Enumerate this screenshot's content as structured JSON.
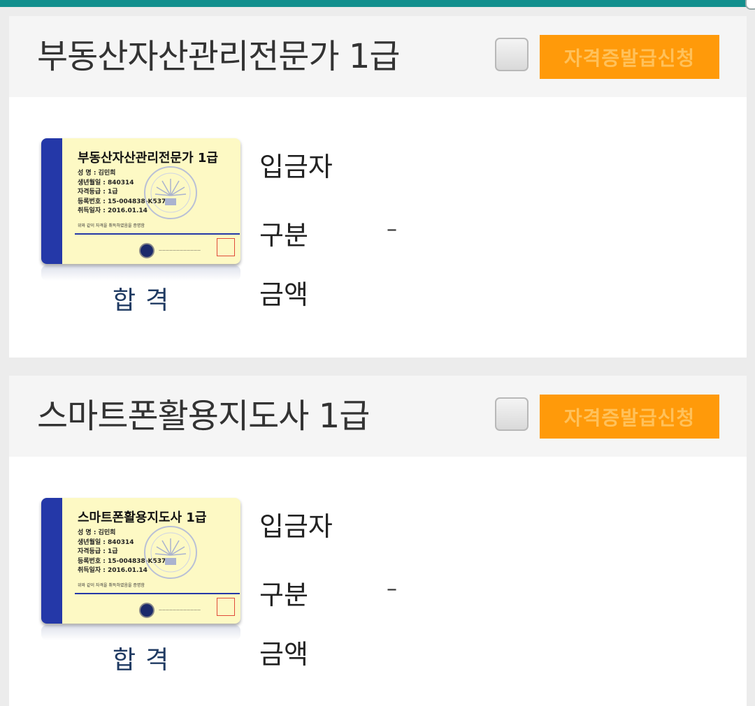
{
  "cards": [
    {
      "title": "부동산자산관리전문가 1급",
      "apply_label": "자격증발급신청",
      "certificate": {
        "title": "부동산자산관리전문가 1급",
        "name_row": "성  명 :  김민희",
        "birth_row": "생년월일 :  840314",
        "grade_row": "자격등급 :  1급",
        "reg_row": "등록번호 :  15-004838-K537",
        "date_row": "취득일자 :  2016.01.14",
        "note": "위와 같이 자격을 취득하였음을 증명함"
      },
      "status": "합격",
      "depositor_label": "입금자",
      "type_label": "구분",
      "type_value": "–",
      "amount_label": "금액"
    },
    {
      "title": "스마트폰활용지도사 1급",
      "apply_label": "자격증발급신청",
      "certificate": {
        "title": "스마트폰활용지도사 1급",
        "name_row": "성  명 :  김민희",
        "birth_row": "생년월일 :  840314",
        "grade_row": "자격등급 :  1급",
        "reg_row": "등록번호 :  15-004838-K537",
        "date_row": "취득일자 :  2016.01.14",
        "note": "위와 같이 자격을 취득하였음을 증명함"
      },
      "status": "합격",
      "depositor_label": "입금자",
      "type_label": "구분",
      "type_value": "–",
      "amount_label": "금액"
    }
  ],
  "colors": {
    "topbar": "#128f8d",
    "apply_button": "#ff9a0a",
    "cert_strip": "#2438a8",
    "cert_bg": "#fdf9c4",
    "status_text": "#1f3a62"
  }
}
